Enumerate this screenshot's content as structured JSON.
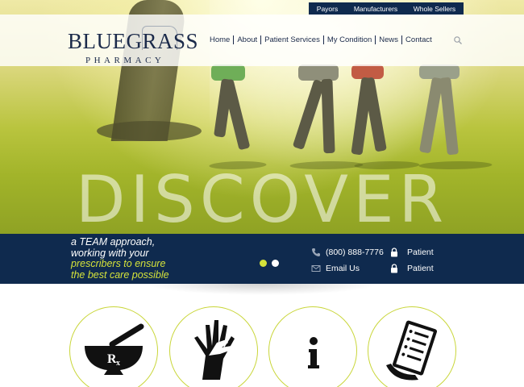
{
  "topbar": {
    "links": [
      "Payors",
      "Manufacturers",
      "Whole Sellers"
    ]
  },
  "logo": {
    "main": "BLUEGRASS",
    "sub": "PHARMACY"
  },
  "nav": {
    "items": [
      "Home",
      "About",
      "Patient Services",
      "My Condition",
      "News",
      "Contact"
    ],
    "search_icon": "search-icon"
  },
  "hero": {
    "headline": "DISCOVER"
  },
  "band": {
    "tagline_line1": "a TEAM approach,",
    "tagline_line2": "working with your",
    "tagline_line3": "prescribers to ensure",
    "tagline_line4": "the best care possible",
    "phone": "(800) 888-7776",
    "email": "Email Us",
    "portal1": "Patient",
    "portal2": "Patient",
    "slides": 2,
    "active_slide": 1
  },
  "colors": {
    "navy": "#0f2a4e",
    "accent": "#d4e23a"
  },
  "features": [
    {
      "icon": "mortar-pestle-rx-icon"
    },
    {
      "icon": "helping-hands-icon"
    },
    {
      "icon": "info-icon"
    },
    {
      "icon": "prescription-list-icon"
    }
  ]
}
